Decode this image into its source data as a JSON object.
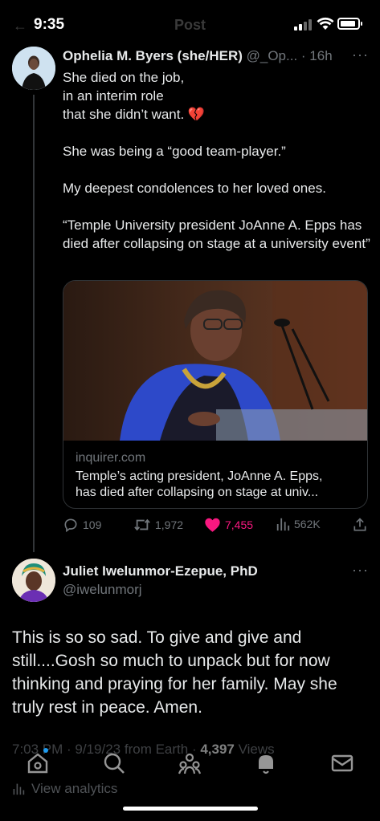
{
  "status_bar": {
    "time": "9:35"
  },
  "header": {
    "title": "Post"
  },
  "tweet": {
    "author_name": "Ophelia M. Byers (she/HER)",
    "handle_age": "@_Op... · 16h",
    "paragraphs": [
      "She died on the job,\nin an interim role\nthat she didn’t want. 💔",
      "She was being a “good team-player.”",
      "My deepest condolences to her loved ones.",
      "“Temple University president JoAnne A. Epps has died after collapsing on stage at a university event”"
    ],
    "card": {
      "domain": "inquirer.com",
      "title_line1": "Temple’s acting president, JoAnne A. Epps,",
      "title_line2": "has died after collapsing on stage at univ..."
    },
    "stats": {
      "replies": "109",
      "reposts": "1,972",
      "likes": "7,455",
      "views": "562K"
    }
  },
  "reply": {
    "author_name": "Juliet Iwelunmor-Ezepue, PhD",
    "handle": "@iwelunmorj",
    "text": "This is so so sad. To give and give and still....Gosh so much to unpack but for now thinking and praying for her family. May she truly rest in peace. Amen.",
    "meta_time": "7:03 PM · 9/19/23 from Earth · ",
    "views_count": "4,397",
    "views_label": " Views",
    "analytics_label": "View analytics"
  },
  "icons": {
    "reply": "reply-icon",
    "repost": "repost-icon",
    "like": "heart-filled-icon",
    "views": "views-icon",
    "share": "share-icon",
    "nav": [
      "home-icon",
      "search-icon",
      "communities-icon",
      "notifications-icon",
      "messages-icon"
    ]
  },
  "colors": {
    "like": "#f91880",
    "accent": "#1d9bf0",
    "muted": "#71767b"
  }
}
